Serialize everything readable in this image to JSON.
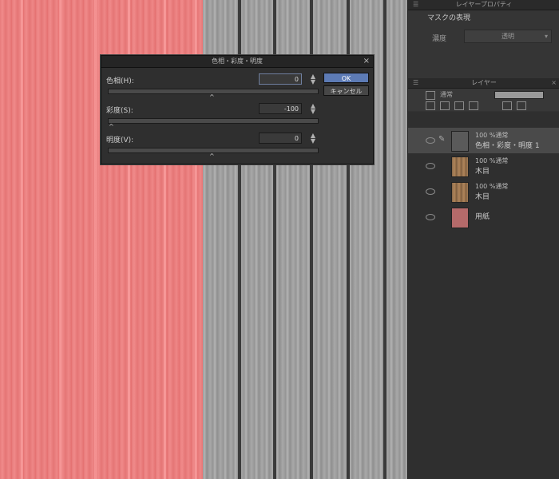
{
  "dialog": {
    "title": "色相・彩度・明度",
    "close_icon": "×",
    "hue_label": "色相(H):",
    "hue_value": "0",
    "saturation_label": "彩度(S):",
    "saturation_value": "-100",
    "brightness_label": "明度(V):",
    "brightness_value": "0",
    "ok_label": "OK",
    "cancel_label": "キャンセル",
    "accent_color": "#5d7bb5"
  },
  "property_panel": {
    "title": "レイヤープロパティ",
    "mask_label": "マスクの表現",
    "expression_label": "濃度",
    "expression_value": "透明"
  },
  "layer_panel": {
    "title": "レイヤー",
    "blend_mode": "通常",
    "opacity": "100",
    "layers": [
      {
        "line1": "100 %通常",
        "line2": "色相・彩度・明度 1",
        "thumb": "adjustment",
        "selected": true
      },
      {
        "line1": "100 %通常",
        "line2": "木目",
        "thumb": "wood",
        "selected": false
      },
      {
        "line1": "100 %通常",
        "line2": "木目",
        "thumb": "wood",
        "selected": false
      },
      {
        "line1": "",
        "line2": "用紙",
        "thumb": "paper",
        "selected": false
      }
    ]
  },
  "colors": {
    "canvas_left": "#e87c7c",
    "canvas_right": "#a0a0a0",
    "panel_bg": "#333333"
  }
}
